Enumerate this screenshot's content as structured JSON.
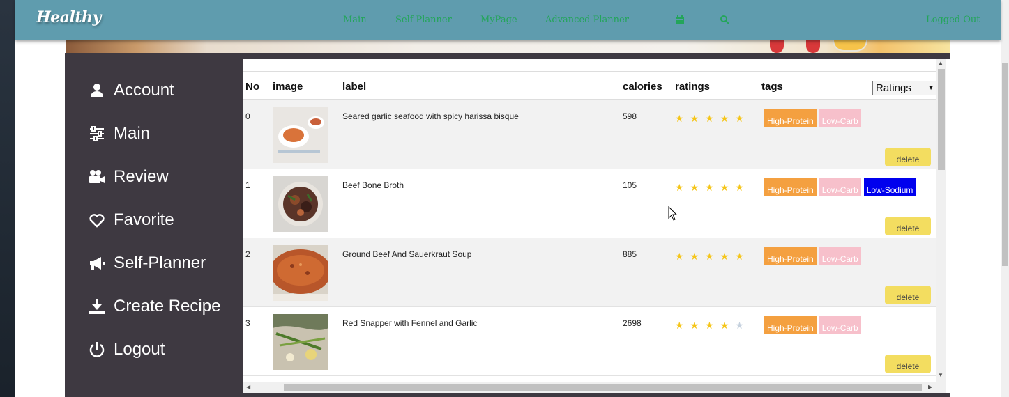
{
  "app": {
    "logo": "Healthy"
  },
  "nav": {
    "links": [
      "Main",
      "Self-Planner",
      "MyPage",
      "Advanced Planner"
    ],
    "icons": [
      "calendar-icon",
      "search-icon"
    ],
    "logout_label": "Logged Out"
  },
  "sidebar": {
    "items": [
      {
        "label": "Account",
        "icon": "user-icon"
      },
      {
        "label": "Main",
        "icon": "sliders-icon"
      },
      {
        "label": "Review",
        "icon": "camera-icon"
      },
      {
        "label": "Favorite",
        "icon": "heart-icon"
      },
      {
        "label": "Self-Planner",
        "icon": "megaphone-icon"
      },
      {
        "label": "Create Recipe",
        "icon": "download-tray-icon"
      },
      {
        "label": "Logout",
        "icon": "power-icon"
      }
    ]
  },
  "table": {
    "headers": {
      "no": "No",
      "image": "image",
      "label": "label",
      "calories": "calories",
      "ratings": "ratings",
      "tags": "tags"
    },
    "sort": {
      "selected": "Ratings"
    },
    "delete_label": "delete",
    "rows": [
      {
        "no": "0",
        "label": "Seared garlic seafood with spicy harissa bisque",
        "calories": "598",
        "rating": 5,
        "tags": [
          "High-Protein",
          "Low-Carb"
        ]
      },
      {
        "no": "1",
        "label": "Beef Bone Broth",
        "calories": "105",
        "rating": 5,
        "tags": [
          "High-Protein",
          "Low-Carb",
          "Low-Sodium"
        ]
      },
      {
        "no": "2",
        "label": "Ground Beef And Sauerkraut Soup",
        "calories": "885",
        "rating": 5,
        "tags": [
          "High-Protein",
          "Low-Carb"
        ]
      },
      {
        "no": "3",
        "label": "Red Snapper with Fennel and Garlic",
        "calories": "2698",
        "rating": 4,
        "tags": [
          "High-Protein",
          "Low-Carb"
        ]
      }
    ]
  },
  "colors": {
    "navbar": "#5f9cae",
    "nav_link": "#23a55a",
    "sidebar": "#3e3941",
    "tag_high_protein": "#f4a040",
    "tag_low_carb": "#f7c0cb",
    "tag_low_sodium": "#0000ee",
    "delete_button": "#f3dd60",
    "star": "#f5c518"
  }
}
